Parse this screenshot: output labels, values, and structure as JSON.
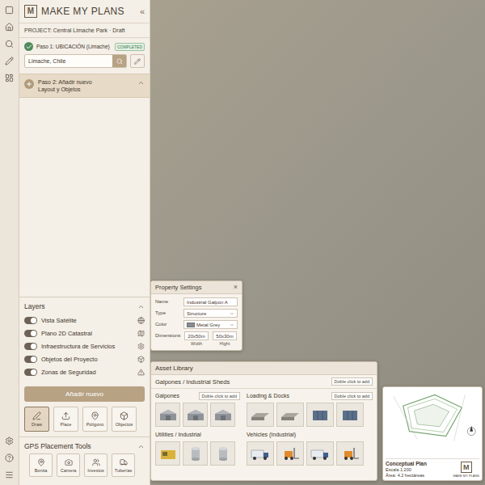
{
  "app": {
    "logo": "M",
    "title": "MAKE MY PLANS",
    "collapse": "«"
  },
  "project": {
    "label": "PROJECT: Central Limache Park · Draft"
  },
  "step1": {
    "label": "Paso 1: UBICACIÓN (Limache)",
    "badge": "COMPLETED",
    "completed": true,
    "location": "Limache, Chile"
  },
  "step2": {
    "lines": [
      "Paso 2: Añadir nuevo",
      "Layout y Objetos"
    ],
    "expanded": true,
    "selected": true
  },
  "layers": {
    "title": "Layers",
    "expanded": true,
    "items": [
      {
        "label": "Vista Satélite",
        "on": true
      },
      {
        "label": "Plano 2D Catastral",
        "on": true
      },
      {
        "label": "Infraestructura de Servicios",
        "on": true
      },
      {
        "label": "Objetos del Proyecto",
        "on": true
      },
      {
        "label": "Zonas de Seguridad",
        "on": true
      }
    ]
  },
  "add_button": "Añadir nuevo",
  "tools": [
    {
      "label": "Draw",
      "selected": true
    },
    {
      "label": "Place",
      "selected": false
    },
    {
      "label": "Polígono",
      "selected": false
    },
    {
      "label": "Objectos",
      "selected": false
    }
  ],
  "gps_tools": {
    "title": "GPS Placement Tools",
    "expanded": true,
    "items": [
      {
        "label": "Bonita",
        "selected": false
      },
      {
        "label": "Camera",
        "selected": false
      },
      {
        "label": "Investos",
        "selected": false
      },
      {
        "label": "Tuberías",
        "selected": false
      }
    ]
  },
  "property_settings": {
    "title": "Property Settings",
    "close": "×",
    "fields": [
      {
        "label": "Name",
        "kind": "text",
        "value": "Industrial Galpón A"
      },
      {
        "label": "Type",
        "kind": "select",
        "value": "Structure"
      },
      {
        "label": "Color",
        "kind": "color",
        "value": "Metal Grey"
      },
      {
        "label": "Dimensions",
        "kind": "dims",
        "parts": [
          {
            "value": "20x50m",
            "caption": "Width"
          },
          {
            "value": "50x30m",
            "caption": "Hight"
          }
        ]
      }
    ]
  },
  "asset_library": {
    "title": "Asset Library",
    "section": {
      "title": "Galpones / Industrial Sheds",
      "action": "Doble click to add"
    },
    "columns": [
      [
        {
          "title": "Galpones",
          "action": "Doble click to add",
          "items": [
            {
              "kind": "shed"
            },
            {
              "kind": "shed"
            },
            {
              "kind": "shed"
            }
          ]
        },
        {
          "title": "Utilities / Industrial",
          "items": [
            {
              "kind": "generator"
            },
            {
              "kind": "tank"
            },
            {
              "kind": "tank"
            }
          ]
        }
      ],
      [
        {
          "title": "Loading & Docks",
          "action": "Doble click to add",
          "items": [
            {
              "kind": "dock"
            },
            {
              "kind": "dock"
            },
            {
              "kind": "container"
            },
            {
              "kind": "container"
            }
          ]
        },
        {
          "title": "Vehicles (Industrial)",
          "items": [
            {
              "kind": "truck"
            },
            {
              "kind": "forklift"
            },
            {
              "kind": "truck"
            },
            {
              "kind": "forklift"
            }
          ]
        }
      ]
    ]
  },
  "conceptual_plan": {
    "title": "Conceptual Plan",
    "scale": "Escala 1:200",
    "area": "Área: 4.2 hectáreas",
    "logo": "M",
    "logo_text": "MAKE MY PLANS"
  }
}
